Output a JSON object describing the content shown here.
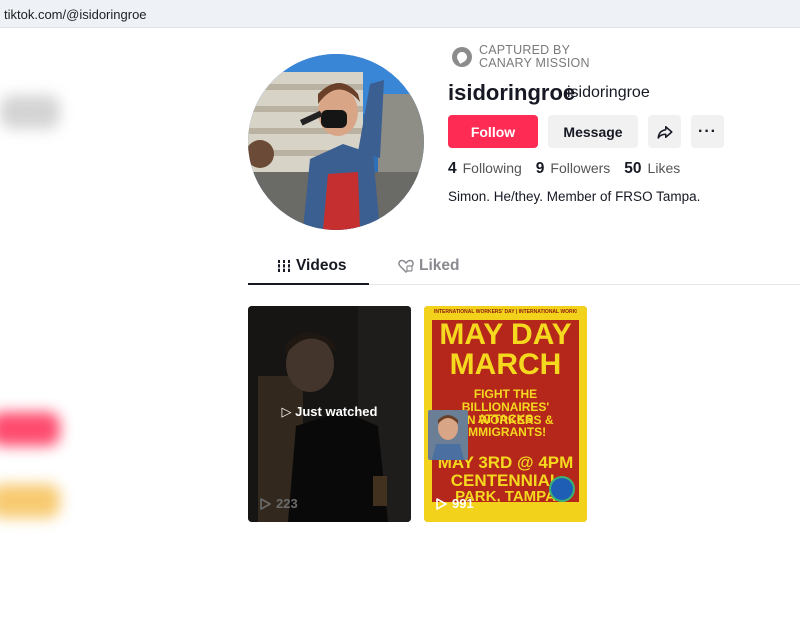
{
  "browser": {
    "url": "tiktok.com/@isidoringroe"
  },
  "watermark": {
    "line1": "CAPTURED BY",
    "line2": "CANARY MISSION"
  },
  "profile": {
    "username": "isidoringroe",
    "nickname": "isidoringroe",
    "follow_label": "Follow",
    "message_label": "Message",
    "more_label": "···",
    "bio": "Simon. He/they. Member of FRSO Tampa."
  },
  "stats": {
    "following": {
      "count": "4",
      "label": "Following"
    },
    "followers": {
      "count": "9",
      "label": "Followers"
    },
    "likes": {
      "count": "50",
      "label": "Likes"
    }
  },
  "tabs": {
    "videos": "Videos",
    "liked": "Liked"
  },
  "videos": [
    {
      "overlay": "Just watched",
      "views": "223"
    },
    {
      "views": "991",
      "poster": {
        "strip": "INTERNATIONAL WORKERS' DAY | INTERNATIONAL WORKERS' DAY",
        "line1": "MAY DAY",
        "line2": "MARCH",
        "line3": "FIGHT THE",
        "line4": "BILLIONAIRES' ATTACKS",
        "line5": "ON WORKERS &",
        "line6": "IMMIGRANTS!",
        "line7": "MAY 3RD @ 4PM",
        "line8": "CENTENNIAL",
        "line9": "PARK, TAMPA"
      }
    }
  ],
  "colors": {
    "accent": "#fe2c55",
    "text": "#161823",
    "muted": "#8a8b91",
    "poster_yellow": "#f5d91f",
    "poster_red": "#b5261b"
  }
}
